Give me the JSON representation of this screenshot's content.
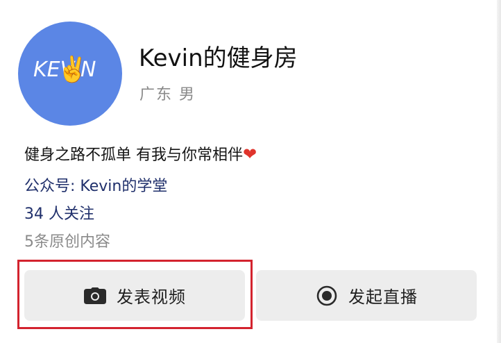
{
  "profile": {
    "avatar_text": "KEVIN",
    "avatar_emoji": "✌️",
    "name": "Kevin的健身房",
    "meta": "广东 男",
    "bio_text": "健身之路不孤单 有我与你常相伴",
    "bio_heart": "❤",
    "account": "公众号: Kevin的学堂",
    "followers": "34 人关注",
    "originals": "5条原创内容"
  },
  "actions": {
    "video_label": "发表视频",
    "live_label": "发起直播"
  },
  "colors": {
    "avatar_bg": "#5b86e5",
    "highlight": "#d3232e",
    "link_text": "#1f2f6b"
  }
}
